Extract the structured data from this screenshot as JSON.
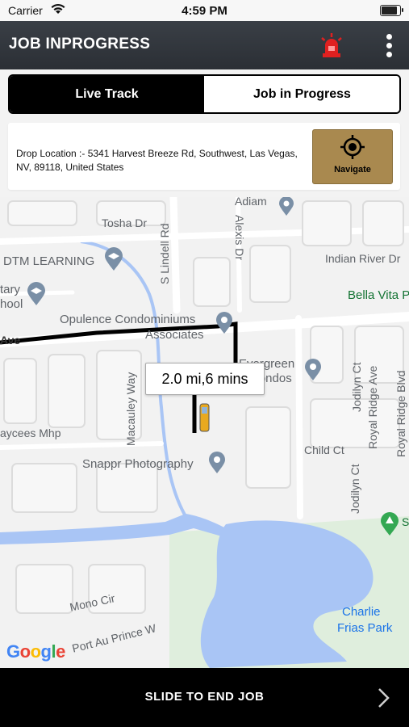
{
  "status_bar": {
    "carrier": "Carrier",
    "time": "4:59 PM"
  },
  "header": {
    "title": "JOB INPROGRESS"
  },
  "tabs": [
    {
      "label": "Live Track"
    },
    {
      "label": "Job in Progress"
    }
  ],
  "drop_location": {
    "text": "Drop Location :- 5341 Harvest Breeze Rd, Southwest, Las Vegas, NV, 89118, United States",
    "navigate_label": "Navigate"
  },
  "map": {
    "eta": "2.0 mi,6 mins",
    "labels": {
      "adiam": "Adiam",
      "tosha": "Tosha Dr",
      "lindell": "S Lindell Rd",
      "alexis": "Alexis Dr",
      "indian_river": "Indian River Dr",
      "dtm": "DTM LEARNING",
      "bella_vita": "Bella Vita P",
      "tary": "tary",
      "hool": "hool",
      "opulence1": "Opulence Condominiums",
      "opulence2": "Associates",
      "ave": "Ave",
      "evergreen1": "Evergreen",
      "evergreen2": "Condos",
      "jodilyn1": "Jodilyn Ct",
      "royal_ridge_ave": "Royal Ridge Ave",
      "royal_ridge_blvd": "Royal Ridge Blvd",
      "macauley": "Macauley Way",
      "jaycees": "aycees Mhp",
      "child": "Child Ct",
      "jodilyn2": "Jodilyn Ct",
      "snappr": "Snappr Photography",
      "mono": "Mono Cir",
      "port_au_prince": "Port Au Prince W",
      "charlie1": "Charlie",
      "charlie2": "Frias Park",
      "s_park": "S"
    },
    "google_logo": {
      "g": "G",
      "o1": "o",
      "o2": "o",
      "g2": "g",
      "l": "l",
      "e": "e"
    }
  },
  "footer": {
    "slide_label": "SLIDE TO END JOB"
  },
  "colors": {
    "header": "#2f3339",
    "accent_gold": "#a9894f",
    "siren": "#e02020",
    "route": "#000000"
  }
}
